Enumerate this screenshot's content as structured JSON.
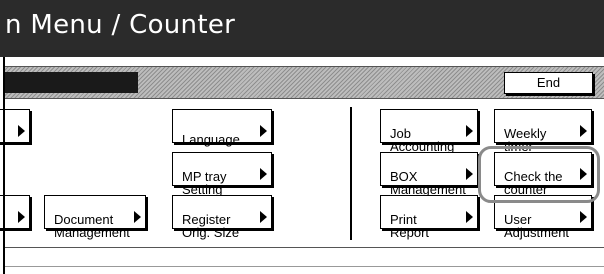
{
  "window": {
    "title": "n Menu / Counter"
  },
  "toolbar": {
    "end_label": "End"
  },
  "buttons": {
    "language": "Language",
    "mp_tray_setting": "MP tray\nSetting",
    "document_management": "Document\nManagement",
    "register_orig_size": "Register\nOrig. Size",
    "job_accounting": "Job\nAccounting",
    "weekly_timer": "Weekly\ntimer",
    "box_management": "BOX\nManagement",
    "check_the_counter": "Check the\ncounter",
    "print_report": "Print\nReport",
    "user_adjustment": "User\nAdjustment"
  },
  "colors": {
    "title_bar": "#2b2b2b",
    "highlight_ring": "#8a8a8a"
  }
}
